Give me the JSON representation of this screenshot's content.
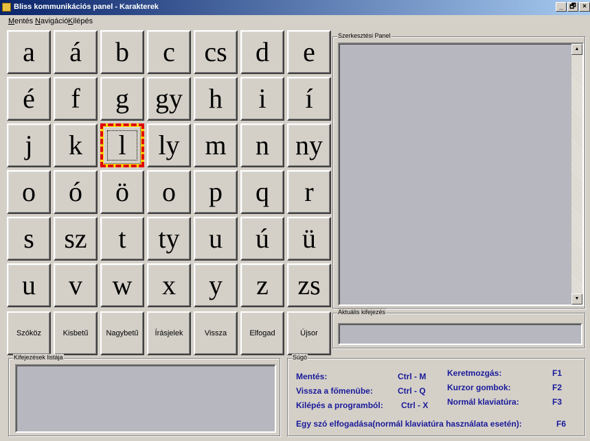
{
  "window": {
    "title": "Bliss kommunikációs panel - Karakterek",
    "buttons": [
      "_",
      "🗗",
      "×"
    ]
  },
  "menu": [
    {
      "first": "M",
      "rest": "entés"
    },
    {
      "first": "N",
      "rest": "avigáció"
    },
    {
      "first": "K",
      "rest": "ilépés"
    }
  ],
  "characters": [
    [
      "a",
      "á",
      "b",
      "c",
      "cs",
      "d",
      "e"
    ],
    [
      "é",
      "f",
      "g",
      "gy",
      "h",
      "i",
      "í"
    ],
    [
      "j",
      "k",
      "l",
      "ly",
      "m",
      "n",
      "ny"
    ],
    [
      "o",
      "ó",
      "ö",
      "o",
      "p",
      "q",
      "r"
    ],
    [
      "s",
      "sz",
      "t",
      "ty",
      "u",
      "ú",
      "ü"
    ],
    [
      "u",
      "v",
      "w",
      "x",
      "y",
      "z",
      "zs"
    ]
  ],
  "selected_character": "l",
  "function_buttons": [
    "Szóköz",
    "Kisbetű",
    "Nagybetű",
    "Írásjelek",
    "Vissza",
    "Elfogad",
    "Újsor"
  ],
  "panels": {
    "edit_panel_label": "Szerkesztési Panel",
    "current_expression_label": "Aktuális kifejezés",
    "expression_list_label": "Kifejezések listája",
    "help_label": "Súgó"
  },
  "help": {
    "save": "Mentés:",
    "save_key": "Ctrl - M",
    "back_main": "Vissza a főmenübe:",
    "back_main_key": "Ctrl - Q",
    "exit": "Kilépés a programból:",
    "exit_key": "Ctrl - X",
    "frame_move": "Keretmozgás:",
    "frame_move_key": "F1",
    "cursor_buttons": "Kurzor gombok:",
    "cursor_buttons_key": "F2",
    "normal_keyboard": "Normál klaviatúra:",
    "normal_keyboard_key": "F3",
    "accept_word": "Egy szó elfogadása(normál klaviatúra használata esetén):",
    "accept_word_key": "F6"
  },
  "colors": {
    "selection_outer": "#e00000",
    "selection_inner": "#ffd800",
    "help_text": "#1a1a9a"
  }
}
